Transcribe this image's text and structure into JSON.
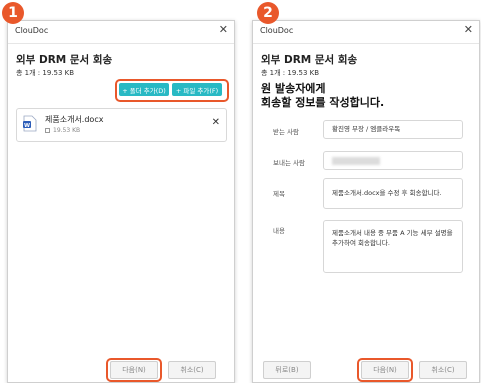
{
  "steps": [
    "1",
    "2"
  ],
  "window1": {
    "app_title": "ClouDoc",
    "close_glyph": "✕",
    "heading": "외부 DRM 문서 회송",
    "summary": "총 1개 : 19.53 KB",
    "add_folder_label": "+ 폴더 추가(D)",
    "add_file_label": "+ 파일 추가(F)",
    "file": {
      "name": "제품소개서.docx",
      "size": "19.53 KB",
      "icon": "word-doc-icon",
      "remove_glyph": "✕"
    },
    "next_label": "다음(N)",
    "cancel_label": "취소(C)"
  },
  "window2": {
    "app_title": "ClouDoc",
    "close_glyph": "✕",
    "heading": "외부 DRM 문서 회송",
    "summary": "총 1개 : 19.53 KB",
    "instruction_line1": "원 발송자에게",
    "instruction_line2": "회송할 정보를 작성합니다.",
    "recipient_label": "받는 사람",
    "recipient_value": "황진영 부장 / 엠클라우독",
    "sender_label": "보내는 사람",
    "subject_label": "제목",
    "subject_value": "제품소개서.docx을 수정 후 회송합니다.",
    "content_label": "내용",
    "content_value": "제품소개서 내용 중 부품 A 기능 세부 설명을 추가하여 회송합니다.",
    "back_label": "뒤로(B)",
    "next_label": "다음(N)",
    "cancel_label": "취소(C)"
  },
  "colors": {
    "accent": "#e9582b",
    "teal": "#28b9c4",
    "word_blue": "#2b5cb8"
  }
}
